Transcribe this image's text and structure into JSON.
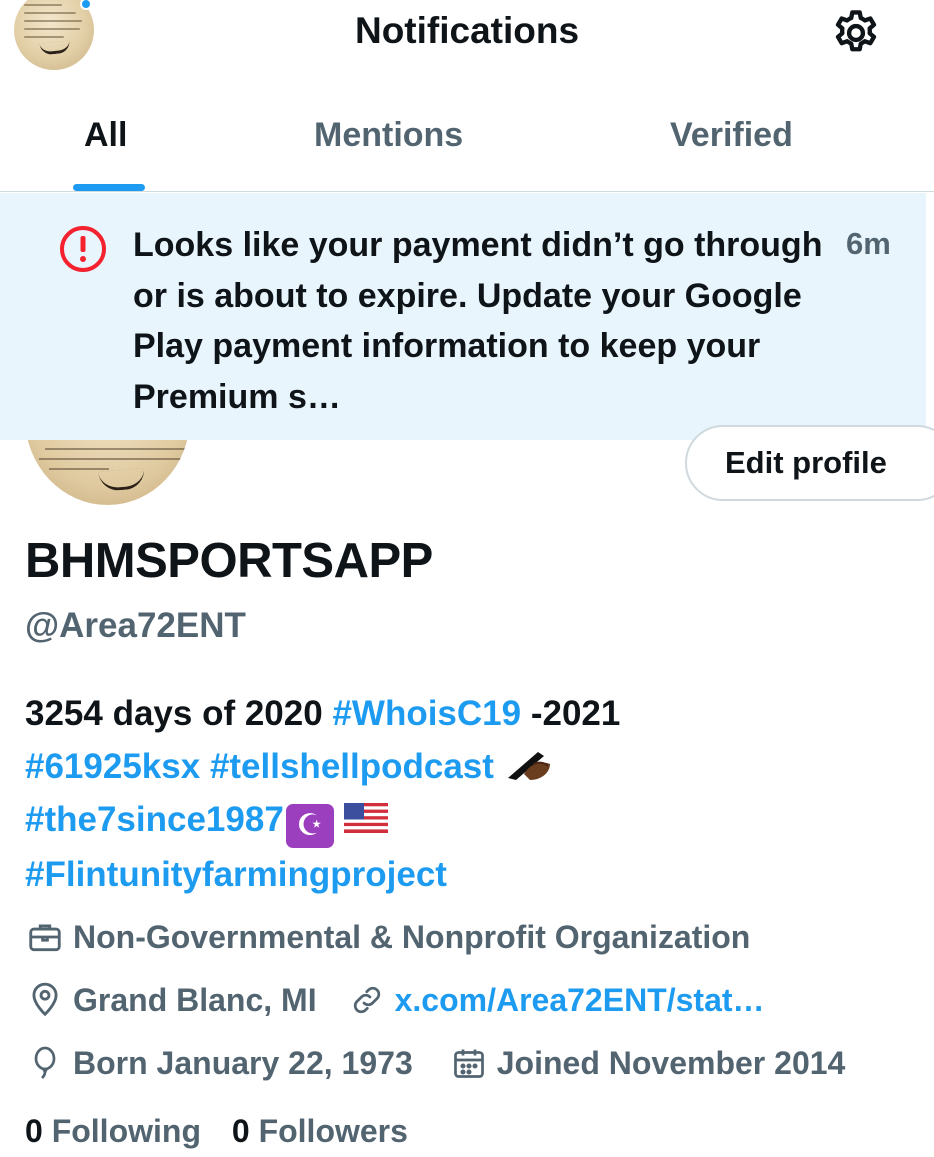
{
  "header": {
    "title": "Notifications",
    "tabs": [
      {
        "label": "All"
      },
      {
        "label": "Mentions"
      },
      {
        "label": "Verified"
      }
    ],
    "active_tab": "All"
  },
  "notification": {
    "icon": "alert-circle-icon",
    "message": "Looks like your payment didn’t go through or is about to expire. Update your Google Play payment information to keep your Premium s…",
    "time": "6m"
  },
  "profile": {
    "edit_label": "Edit profile",
    "display_name": "BHMSPORTSAPP",
    "handle": "@Area72ENT",
    "bio": {
      "line1_text": "3254 days of 2020",
      "line1_tag": "#WhoisC19",
      "line1_tail": "-2021",
      "line2_tag1": "#61925ksx",
      "line2_tag2": "#tellshellpodcast",
      "line3_tag": "#the7since1987",
      "line4_tag": "#Flintunityfarmingproject"
    },
    "category": "Non-Governmental & Nonprofit Organization",
    "location": "Grand Blanc, MI",
    "website": "x.com/Area72ENT/stat…",
    "born": "Born January 22, 1973",
    "joined": "Joined November 2014",
    "following_count": "0",
    "following_label": "Following",
    "followers_count": "0",
    "followers_label": "Followers"
  },
  "colors": {
    "accent": "#1d9bf0",
    "alert": "#f4212e",
    "notification_bg": "#e8f5fd",
    "secondary_text": "#536471"
  }
}
